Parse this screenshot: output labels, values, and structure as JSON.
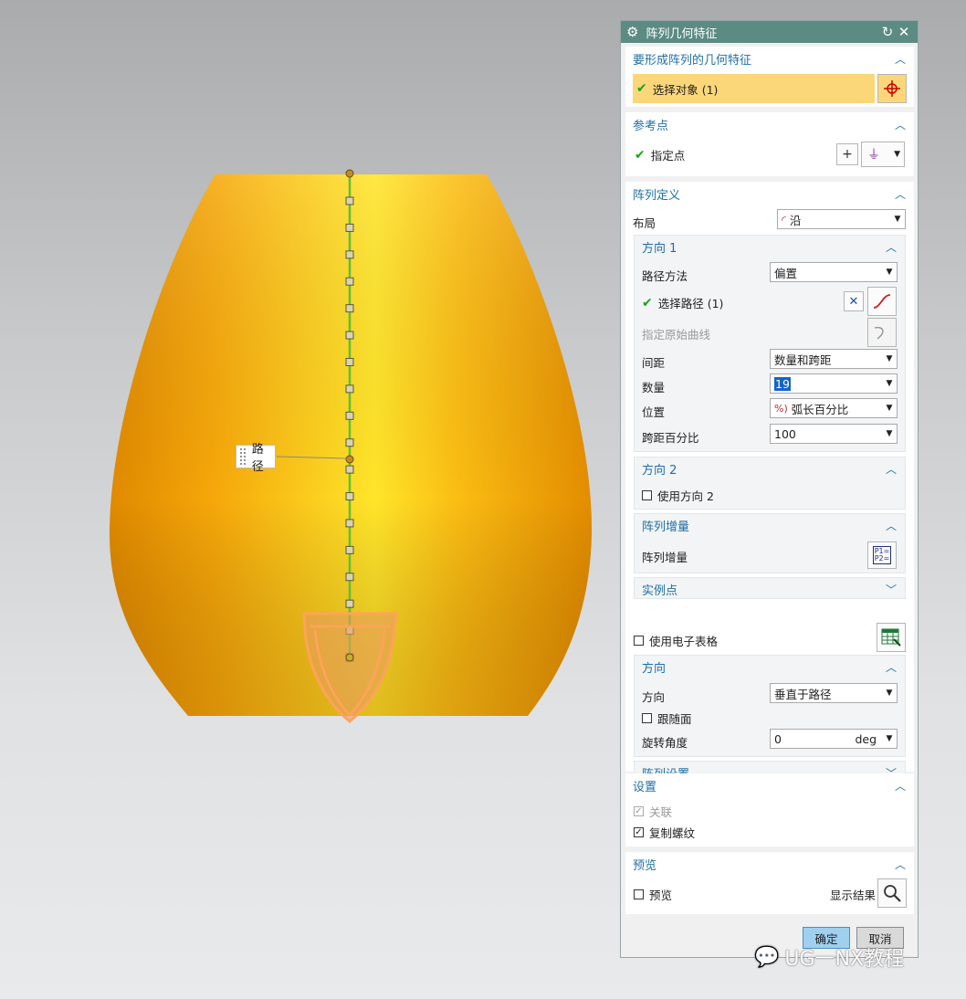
{
  "viewport": {
    "path_tag": "路径"
  },
  "dialog": {
    "title": "阵列几何特征",
    "g1": {
      "title": "要形成阵列的几何特征",
      "select_label": "选择对象 (1)"
    },
    "g2": {
      "title": "参考点",
      "point_label": "指定点"
    },
    "g3": {
      "title": "阵列定义",
      "layout_label": "布局",
      "layout_value": "沿",
      "dir1": {
        "title": "方向 1",
        "path_method_label": "路径方法",
        "path_method_value": "偏置",
        "select_path_label": "选择路径 (1)",
        "orig_curve_label": "指定原始曲线",
        "spacing_label": "间距",
        "spacing_value": "数量和跨距",
        "count_label": "数量",
        "count_value": "19",
        "position_label": "位置",
        "position_value": "弧长百分比",
        "span_pct_label": "跨距百分比",
        "span_pct_value": "100"
      },
      "dir2": {
        "title": "方向 2",
        "use_dir2_label": "使用方向 2"
      },
      "increment": {
        "title": "阵列增量",
        "label": "阵列增量"
      },
      "instance": {
        "title": "实例点"
      },
      "spreadsheet_label": "使用电子表格",
      "orient": {
        "title": "方向",
        "direction_label": "方向",
        "direction_value": "垂直于路径",
        "follow_face_label": "跟随面",
        "rot_angle_label": "旋转角度",
        "rot_angle_value": "0",
        "rot_angle_unit": "deg"
      },
      "settings_sub": {
        "title": "阵列设置"
      }
    },
    "g4": {
      "title": "设置",
      "assoc_label": "关联",
      "copy_thread_label": "复制螺纹"
    },
    "g5": {
      "title": "预览",
      "preview_label": "预览",
      "show_result_label": "显示结果"
    },
    "ok_label": "确定",
    "cancel_label": "取消"
  },
  "watermark": "UG一NX教程",
  "colors": {
    "accent": "#1f6fa8",
    "title_bar": "#5c8b84",
    "selection": "#fbd779",
    "body": "#f2a20c"
  }
}
